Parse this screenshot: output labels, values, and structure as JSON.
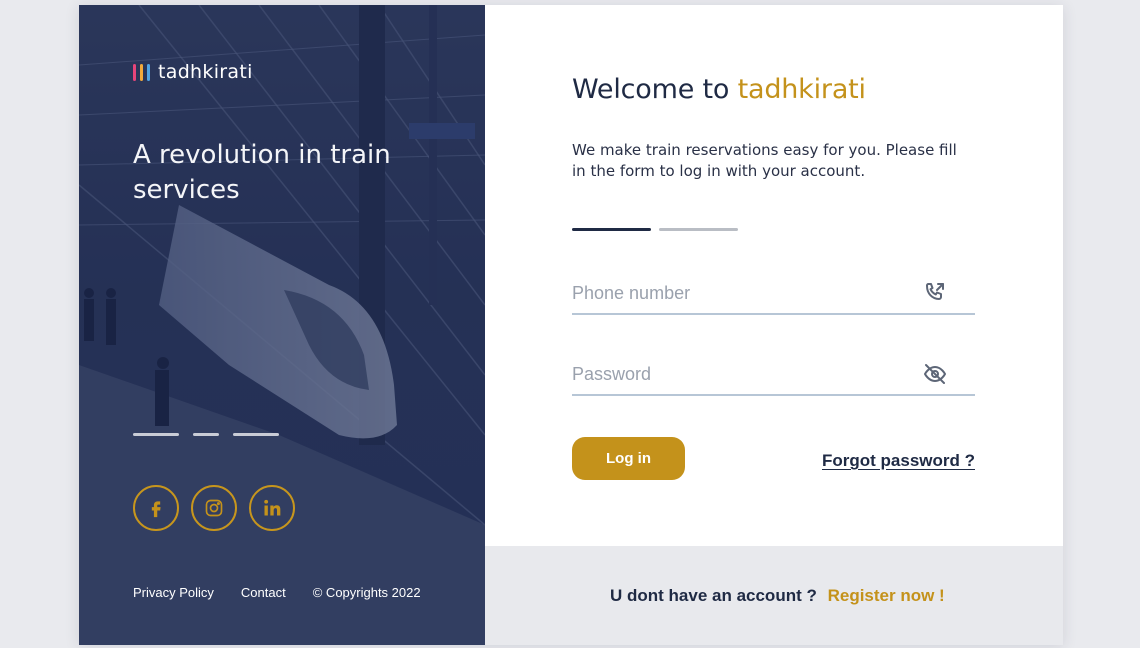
{
  "brand": {
    "name": "tadhkirati",
    "bar_colors": [
      "#e6457a",
      "#f2a93b",
      "#4fa3e3"
    ]
  },
  "left": {
    "tagline": "A revolution in train services",
    "social": [
      {
        "icon": "facebook-icon"
      },
      {
        "icon": "instagram-icon"
      },
      {
        "icon": "linkedin-icon"
      }
    ],
    "footer": {
      "privacy": "Privacy Policy",
      "contact": "Contact",
      "copyright": "© Copyrights 2022"
    }
  },
  "form": {
    "welcome_prefix": "Welcome to",
    "welcome_brand": "tadhkirati",
    "description": "We make train reservations easy for you. Please fill in the form to log in with your account.",
    "phone_placeholder": "Phone number",
    "password_placeholder": "Password",
    "login_label": "Log in",
    "forgot_label": "Forgot password ?",
    "no_account_text": "U dont have an account ?",
    "register_label": "Register now !"
  },
  "colors": {
    "accent": "#c4921b",
    "navy": "#1f2a44",
    "field_line": "#b7c6d6",
    "step_active": "#1f2a44",
    "step_inactive": "#b9bdc4"
  }
}
